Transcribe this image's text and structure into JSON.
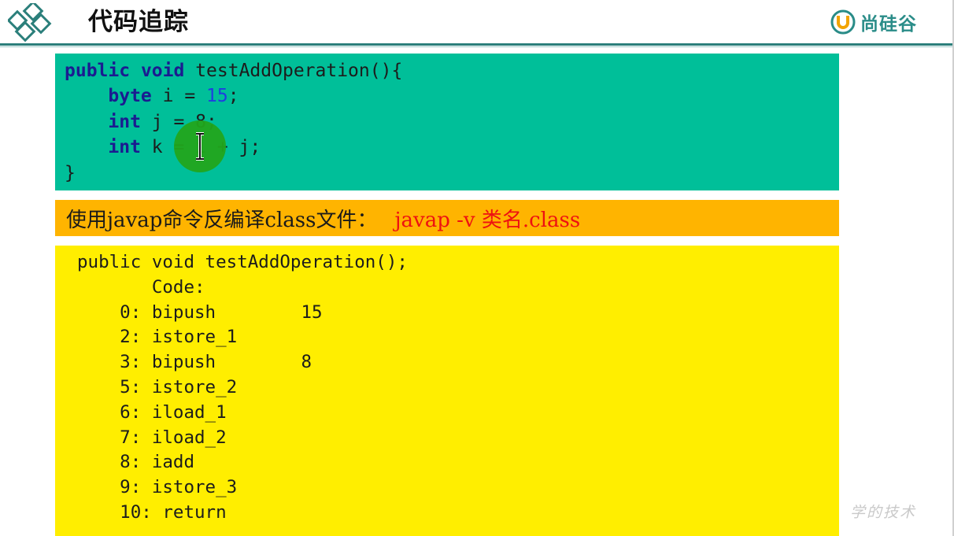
{
  "header": {
    "title": "代码追踪",
    "logo_text": "尚硅谷",
    "accent_color": "#2b7f7b",
    "logo_color": "#2a8c88"
  },
  "java_code": {
    "background": "#00bf99",
    "lines": [
      [
        {
          "t": "public",
          "c": "kw"
        },
        {
          "t": " "
        },
        {
          "t": "void",
          "c": "kw"
        },
        {
          "t": " testAddOperation(){"
        }
      ],
      [
        {
          "t": "    "
        },
        {
          "t": "byte",
          "c": "kw"
        },
        {
          "t": " i = "
        },
        {
          "t": "15",
          "c": "num"
        },
        {
          "t": ";"
        }
      ],
      [
        {
          "t": "    "
        },
        {
          "t": "int",
          "c": "kw"
        },
        {
          "t": " j = 8;"
        }
      ],
      [
        {
          "t": "    "
        },
        {
          "t": "int",
          "c": "kw"
        },
        {
          "t": " k = i + j;"
        }
      ],
      [
        {
          "t": "}"
        }
      ]
    ]
  },
  "banner": {
    "label": "使用javap命令反编译class文件：",
    "command": "javap -v 类名.class",
    "background": "#ffb400",
    "command_color": "#ee1111"
  },
  "bytecode": {
    "background": "#ffee00",
    "lines": [
      "public void testAddOperation();",
      "       Code:",
      "    0: bipush        15",
      "    2: istore_1",
      "    3: bipush        8",
      "    5: istore_2",
      "    6: iload_1",
      "    7: iload_2",
      "    8: iadd",
      "    9: istore_3",
      "    10: return"
    ]
  },
  "icons": {
    "header_decoration": "diamond-pattern-icon",
    "logo_mark": "u-shield-logo-icon",
    "cursor": "text-cursor-icon",
    "cursor_highlight": "mouse-highlight-circle"
  },
  "watermark": "学的技术"
}
